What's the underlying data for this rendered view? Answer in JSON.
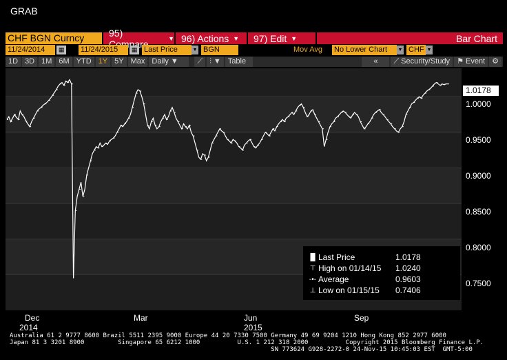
{
  "window": {
    "title": "GRAB"
  },
  "toolbar": {
    "ticker": "CHF BGN Curncy",
    "menus": [
      {
        "label": "95) Compare"
      },
      {
        "label": "96) Actions"
      },
      {
        "label": "97) Edit"
      }
    ],
    "chart_title": "Bar Chart"
  },
  "params": {
    "start_date": "11/24/2014",
    "end_date": "11/24/2015",
    "price_field": "Last Price",
    "source": "BGN",
    "study": "Mov Avg",
    "lower_chart": "No Lower Chart",
    "currency": "CHF"
  },
  "range_buttons": [
    "1D",
    "3D",
    "1M",
    "6M",
    "YTD",
    "1Y",
    "5Y",
    "Max"
  ],
  "active_range": "1Y",
  "interval": "Daily",
  "row3": {
    "table": "Table",
    "security_study": "Security/Study",
    "event": "Event"
  },
  "yaxis": {
    "labels": [
      "1.0000",
      "0.9500",
      "0.9000",
      "0.8500",
      "0.8000",
      "0.7500"
    ],
    "last_value": "1.0178"
  },
  "xaxis": {
    "labels": [
      {
        "text": "Dec",
        "sub": "2014"
      },
      {
        "text": "Mar",
        "sub": ""
      },
      {
        "text": "Jun",
        "sub": "2015"
      },
      {
        "text": "Sep",
        "sub": ""
      }
    ]
  },
  "legend": {
    "rows": [
      {
        "label": "Last Price",
        "value": "1.0178"
      },
      {
        "label": "High on 01/14/15",
        "value": "1.0240"
      },
      {
        "label": "Average",
        "value": "0.9603"
      },
      {
        "label": "Low on 01/15/15",
        "value": "0.7406"
      }
    ]
  },
  "footer": {
    "line1": "Australia 61 2 9777 8600 Brazil 5511 2395 9000 Europe 44 20 7330 7500 Germany 49 69 9204 1210 Hong Kong 852 2977 6000",
    "line2": "Japan 81 3 3201 8900         Singapore 65 6212 1000          U.S. 1 212 318 2000          Copyright 2015 Bloomberg Finance L.P.",
    "line3": "                                                                      SN 773624 G928-2272-0 24-Nov-15 10:45:03 EST  GMT-5:00"
  },
  "chart_data": {
    "type": "line",
    "ylim": [
      0.7,
      1.04
    ],
    "x_points": 255,
    "series": [
      {
        "values": [
          0.968,
          0.972,
          0.965,
          0.97,
          0.975,
          0.971,
          0.968,
          0.98,
          0.975,
          0.972,
          0.966,
          0.962,
          0.958,
          0.965,
          0.97,
          0.975,
          0.98,
          0.983,
          0.985,
          0.988,
          0.99,
          0.992,
          0.995,
          0.998,
          1.002,
          1.006,
          1.01,
          1.015,
          1.018,
          1.02,
          1.016,
          1.022,
          1.02,
          1.024,
          1.018,
          0.745,
          0.84,
          0.86,
          0.87,
          0.88,
          0.86,
          0.87,
          0.89,
          0.9,
          0.91,
          0.92,
          0.925,
          0.93,
          0.928,
          0.935,
          0.93,
          0.932,
          0.935,
          0.933,
          0.938,
          0.94,
          0.942,
          0.945,
          0.95,
          0.955,
          0.96,
          0.958,
          0.962,
          0.965,
          0.97,
          0.975,
          0.985,
          0.995,
          1.005,
          1.01,
          1.008,
          1.0,
          0.99,
          0.975,
          0.96,
          0.955,
          0.965,
          0.97,
          0.96,
          0.955,
          0.958,
          0.965,
          0.97,
          0.975,
          0.968,
          0.972,
          0.98,
          0.985,
          0.978,
          0.97,
          0.965,
          0.96,
          0.955,
          0.962,
          0.958,
          0.955,
          0.96,
          0.95,
          0.945,
          0.935,
          0.925,
          0.915,
          0.912,
          0.92,
          0.918,
          0.91,
          0.915,
          0.925,
          0.935,
          0.94,
          0.945,
          0.95,
          0.955,
          0.952,
          0.95,
          0.945,
          0.94,
          0.938,
          0.935,
          0.94,
          0.938,
          0.935,
          0.93,
          0.928,
          0.925,
          0.932,
          0.935,
          0.938,
          0.94,
          0.935,
          0.93,
          0.928,
          0.932,
          0.935,
          0.94,
          0.945,
          0.95,
          0.948,
          0.945,
          0.95,
          0.955,
          0.952,
          0.958,
          0.962,
          0.965,
          0.968,
          0.965,
          0.97,
          0.972,
          0.975,
          0.978,
          0.975,
          0.98,
          0.985,
          0.988,
          0.99,
          0.985,
          0.978,
          0.972,
          0.975,
          0.98,
          0.982,
          0.975,
          0.97,
          0.965,
          0.96,
          0.955,
          0.93,
          0.94,
          0.95,
          0.958,
          0.962,
          0.965,
          0.97,
          0.972,
          0.975,
          0.978,
          0.98,
          0.978,
          0.975,
          0.972,
          0.97,
          0.975,
          0.978,
          0.975,
          0.972,
          0.965,
          0.96,
          0.955,
          0.958,
          0.962,
          0.965,
          0.97,
          0.975,
          0.978,
          0.98,
          0.982,
          0.978,
          0.975,
          0.972,
          0.968,
          0.965,
          0.962,
          0.958,
          0.955,
          0.952,
          0.95,
          0.955,
          0.958,
          0.965,
          0.975,
          0.98,
          0.985,
          0.99,
          0.992,
          0.995,
          0.998,
          1.0,
          0.998,
          1.002,
          1.005,
          1.008,
          1.01,
          1.012,
          1.015,
          1.018,
          1.02,
          1.018,
          1.016,
          1.018,
          1.017,
          1.018,
          1.018
        ]
      }
    ]
  }
}
